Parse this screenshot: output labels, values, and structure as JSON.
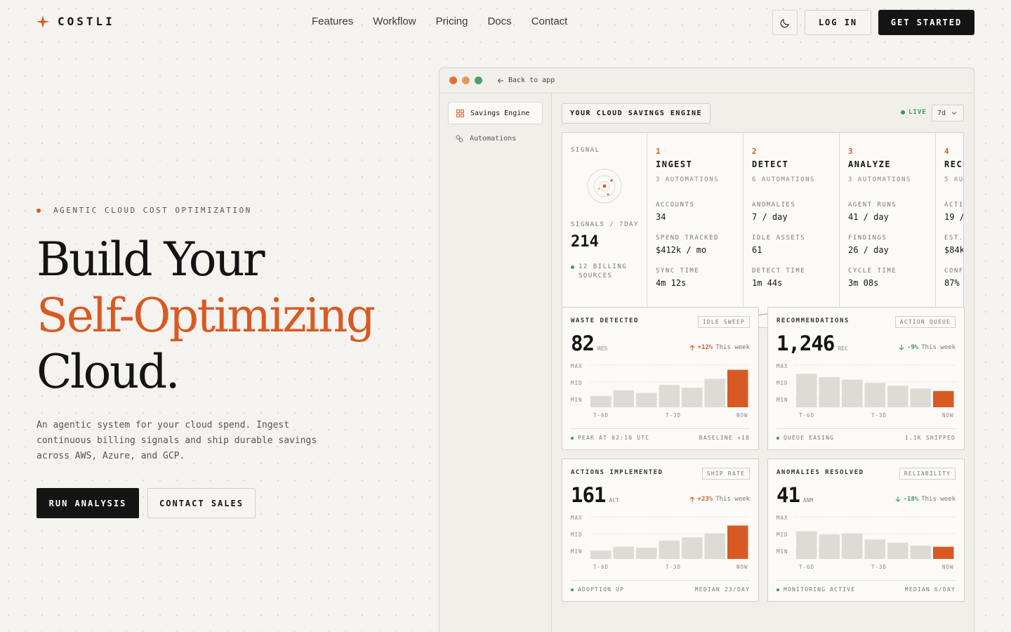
{
  "brand": {
    "name": "COSTLI",
    "accent": "#d85a23"
  },
  "nav": {
    "links": [
      "Features",
      "Workflow",
      "Pricing",
      "Docs",
      "Contact"
    ],
    "login": "LOG IN",
    "get_started": "GET STARTED"
  },
  "hero": {
    "eyebrow": "AGENTIC CLOUD COST OPTIMIZATION",
    "headline_1": "Build Your",
    "headline_2": "Self-Optimizing",
    "headline_3": "Cloud.",
    "description": "An agentic system for your cloud spend. Ingest continuous billing signals and ship durable savings across AWS, Azure, and GCP.",
    "cta_primary": "RUN ANALYSIS",
    "cta_secondary": "CONTACT SALES"
  },
  "app": {
    "back": "Back to app",
    "sidebar": [
      "Savings Engine",
      "Automations"
    ],
    "engine_title": "YOUR CLOUD SAVINGS ENGINE",
    "live": "LIVE",
    "range": "7d",
    "signal": {
      "label": "SIGNAL",
      "count_label": "SIGNALS / 7DAY",
      "count": "214",
      "sources": "12 BILLING SOURCES"
    },
    "stages": [
      {
        "num": "1",
        "name": "INGEST",
        "sub": "3 AUTOMATIONS",
        "m": [
          [
            "ACCOUNTS",
            "34"
          ],
          [
            "SPEND TRACKED",
            "$412k / mo"
          ],
          [
            "SYNC TIME",
            "4m 12s"
          ]
        ]
      },
      {
        "num": "2",
        "name": "DETECT",
        "sub": "6 AUTOMATIONS",
        "m": [
          [
            "ANOMALIES",
            "7 / day"
          ],
          [
            "IDLE ASSETS",
            "61"
          ],
          [
            "DETECT TIME",
            "1m 44s"
          ]
        ]
      },
      {
        "num": "3",
        "name": "ANALYZE",
        "sub": "3 AUTOMATIONS",
        "m": [
          [
            "AGENT RUNS",
            "41 / day"
          ],
          [
            "FINDINGS",
            "26 / day"
          ],
          [
            "CYCLE TIME",
            "3m 08s"
          ]
        ]
      },
      {
        "num": "4",
        "name": "RECO",
        "sub": "5 AU",
        "m": [
          [
            "ACTI",
            "19 /"
          ],
          [
            "EST.",
            "$84k"
          ],
          [
            "CONF",
            "87%"
          ]
        ]
      }
    ],
    "cards": [
      {
        "title": "WASTE DETECTED",
        "tag": "IDLE SWEEP",
        "value": "82",
        "unit": "RES",
        "delta": "+12%",
        "dir": "up",
        "week": "This week",
        "foot_l": "PEAK AT 02:10 UTC",
        "foot_r": "BASELINE +18",
        "bars": [
          0.28,
          0.42,
          0.35,
          0.55,
          0.48,
          0.7,
          0.92
        ]
      },
      {
        "title": "RECOMMENDATIONS",
        "tag": "ACTION QUEUE",
        "value": "1,246",
        "unit": "REC",
        "delta": "-9%",
        "dir": "down",
        "week": "This week",
        "foot_l": "QUEUE EASING",
        "foot_r": "1.1K SHIPPED",
        "bars": [
          0.82,
          0.74,
          0.68,
          0.6,
          0.53,
          0.46,
          0.4
        ]
      },
      {
        "title": "ACTIONS IMPLEMENTED",
        "tag": "SHIP RATE",
        "value": "161",
        "unit": "ACT",
        "delta": "+23%",
        "dir": "up",
        "week": "This week",
        "foot_l": "ADOPTION UP",
        "foot_r": "MEDIAN 23/DAY",
        "bars": [
          0.2,
          0.3,
          0.28,
          0.45,
          0.53,
          0.63,
          0.82
        ]
      },
      {
        "title": "ANOMALIES RESOLVED",
        "tag": "RELIABILITY",
        "value": "41",
        "unit": "ANM",
        "delta": "-18%",
        "dir": "down",
        "week": "This week",
        "foot_l": "MONITORING ACTIVE",
        "foot_r": "MEDIAN 6/DAY",
        "bars": [
          0.68,
          0.6,
          0.63,
          0.48,
          0.4,
          0.33,
          0.3
        ]
      }
    ],
    "axis": {
      "max": "MAX",
      "mid": "MID",
      "min": "MIN",
      "t6": "T-6D",
      "t3": "T-3D",
      "now": "NOW"
    }
  }
}
